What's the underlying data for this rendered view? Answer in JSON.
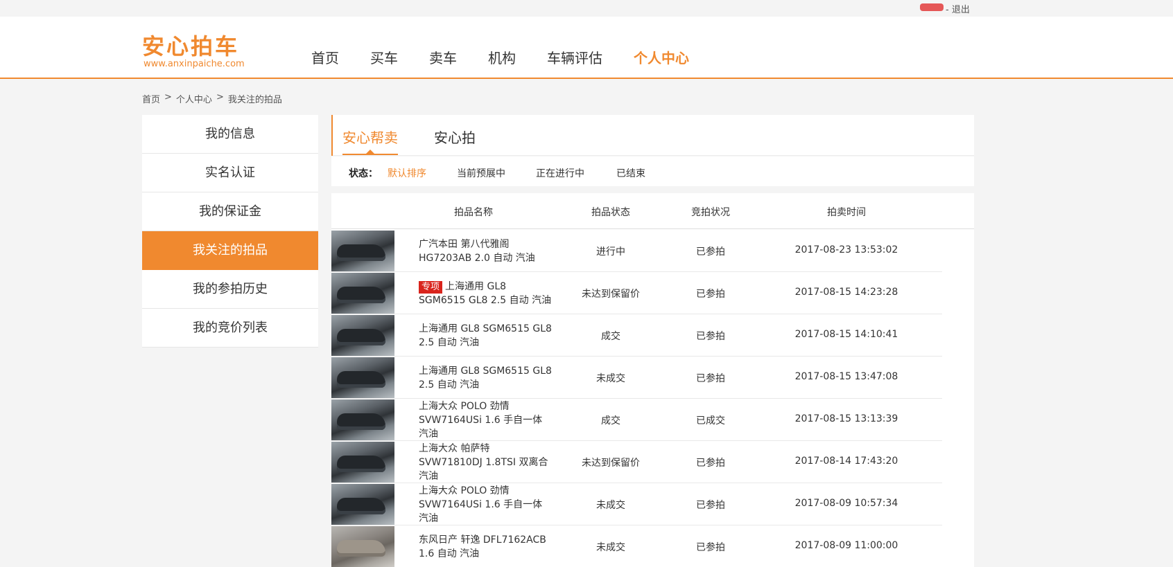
{
  "topbar": {
    "logout": "- 退出"
  },
  "logo": {
    "cn": "安心拍车",
    "en": "www.anxinpaiche.com"
  },
  "nav": [
    "首页",
    "买车",
    "卖车",
    "机构",
    "车辆评估",
    "个人中心"
  ],
  "breadcrumb": [
    "首页",
    ">",
    "个人中心",
    ">",
    "我关注的拍品"
  ],
  "sidebar": [
    "我的信息",
    "实名认证",
    "我的保证金",
    "我关注的拍品",
    "我的参拍历史",
    "我的竞价列表"
  ],
  "tabs": [
    "安心帮卖",
    "安心拍"
  ],
  "filters": {
    "label": "状态：",
    "options": [
      "默认排序",
      "当前预展中",
      "正在进行中",
      "已结束"
    ]
  },
  "table": {
    "headers": [
      "拍品名称",
      "拍品状态",
      "竞拍状况",
      "拍卖时间"
    ],
    "rows": [
      {
        "tag": "",
        "name": "广汽本田 第八代雅阁 HG7203AB 2.0 自动 汽油",
        "status": "进行中",
        "bid": "已参拍",
        "time": "2017-08-23 13:53:02"
      },
      {
        "tag": "专项",
        "name": "上海通用 GL8 SGM6515 GL8 2.5 自动 汽油",
        "status": "未达到保留价",
        "bid": "已参拍",
        "time": "2017-08-15 14:23:28"
      },
      {
        "tag": "",
        "name": "上海通用 GL8 SGM6515 GL8 2.5 自动 汽油",
        "status": "成交",
        "bid": "已参拍",
        "time": "2017-08-15 14:10:41"
      },
      {
        "tag": "",
        "name": "上海通用 GL8 SGM6515 GL8 2.5 自动 汽油",
        "status": "未成交",
        "bid": "已参拍",
        "time": "2017-08-15 13:47:08"
      },
      {
        "tag": "",
        "name": "上海大众 POLO 劲情 SVW7164USi 1.6 手自一体 汽油",
        "status": "成交",
        "bid": "已成交",
        "time": "2017-08-15 13:13:39"
      },
      {
        "tag": "",
        "name": "上海大众 帕萨特 SVW71810DJ 1.8TSI 双离合 汽油",
        "status": "未达到保留价",
        "bid": "已参拍",
        "time": "2017-08-14 17:43:20"
      },
      {
        "tag": "",
        "name": "上海大众 POLO 劲情 SVW7164USi 1.6 手自一体 汽油",
        "status": "未成交",
        "bid": "已参拍",
        "time": "2017-08-09 10:57:34"
      },
      {
        "tag": "",
        "name": "东风日产 轩逸 DFL7162ACB 1.6 自动 汽油",
        "status": "未成交",
        "bid": "已参拍",
        "time": "2017-08-09 11:00:00"
      }
    ]
  }
}
